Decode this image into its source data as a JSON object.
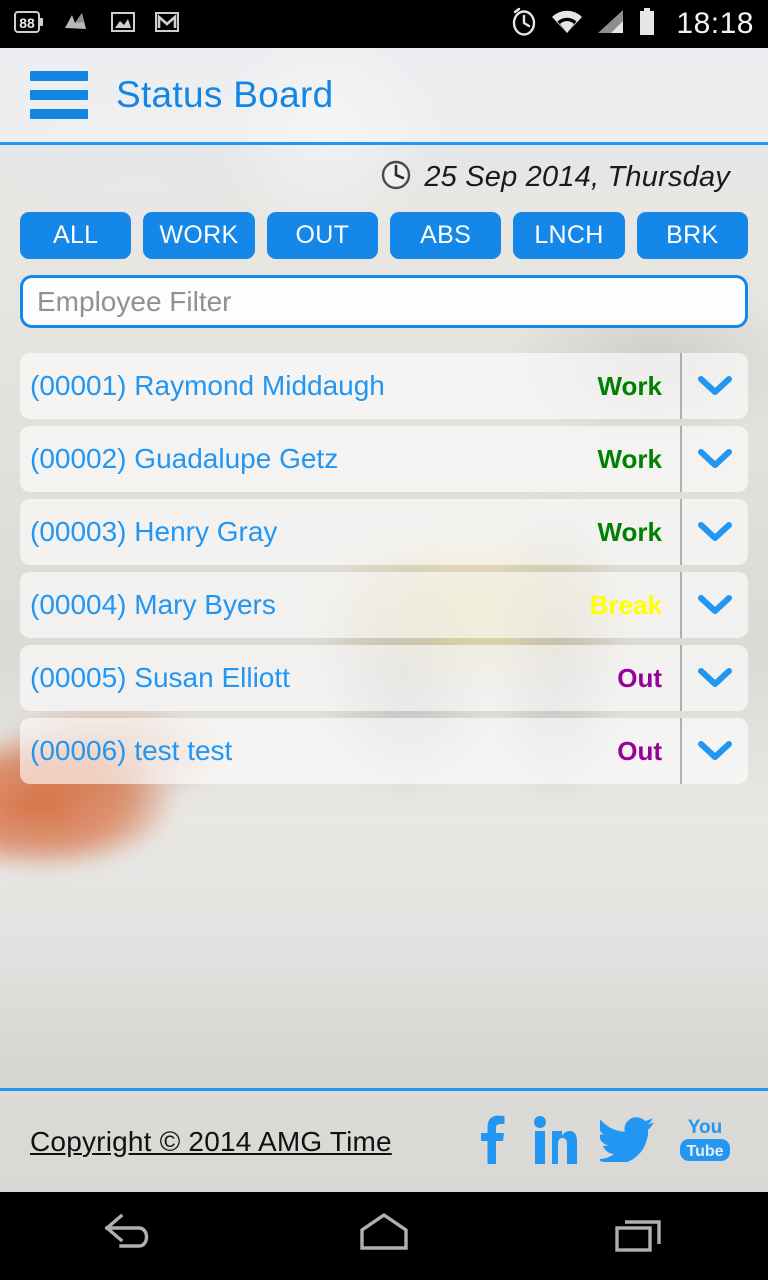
{
  "statusbar": {
    "icons": [
      {
        "name": "battery-88-badge-icon",
        "label": "88"
      },
      {
        "name": "sketch-app-icon",
        "label": ""
      },
      {
        "name": "gallery-image-icon",
        "label": ""
      },
      {
        "name": "gmail-icon",
        "label": ""
      }
    ],
    "right_icons": [
      {
        "name": "alarm-clock-icon"
      },
      {
        "name": "wifi-icon"
      },
      {
        "name": "cellular-signal-icon"
      },
      {
        "name": "battery-icon"
      }
    ],
    "time": "18:18"
  },
  "actionbar": {
    "menu_icon": "hamburger-menu-icon",
    "title": "Status Board"
  },
  "date_row": {
    "clock_icon": "clock-icon",
    "date": "25 Sep 2014, Thursday"
  },
  "filters": [
    {
      "id": "all",
      "label": "ALL"
    },
    {
      "id": "work",
      "label": "WORK"
    },
    {
      "id": "out",
      "label": "OUT"
    },
    {
      "id": "abs",
      "label": "ABS"
    },
    {
      "id": "lnch",
      "label": "LNCH"
    },
    {
      "id": "brk",
      "label": "BRK"
    }
  ],
  "search": {
    "placeholder": "Employee Filter",
    "value": ""
  },
  "status_colors": {
    "work": "#008000",
    "break": "#ffff00",
    "out": "#990099",
    "accent": "#1587e8",
    "name": "#2196f3"
  },
  "employees": [
    {
      "code": "(00001)",
      "name": "Raymond Middaugh",
      "display": "(00001) Raymond Middaugh",
      "status": "Work",
      "status_color": "#008000",
      "expand_icon": "chevron-down-icon"
    },
    {
      "code": "(00002)",
      "name": "Guadalupe Getz",
      "display": "(00002) Guadalupe Getz",
      "status": "Work",
      "status_color": "#008000",
      "expand_icon": "chevron-down-icon"
    },
    {
      "code": "(00003)",
      "name": "Henry Gray",
      "display": "(00003) Henry Gray",
      "status": "Work",
      "status_color": "#008000",
      "expand_icon": "chevron-down-icon"
    },
    {
      "code": "(00004)",
      "name": "Mary Byers",
      "display": "(00004) Mary Byers",
      "status": "Break",
      "status_color": "#ffff00",
      "expand_icon": "chevron-down-icon"
    },
    {
      "code": "(00005)",
      "name": "Susan Elliott",
      "display": "(00005) Susan Elliott",
      "status": "Out",
      "status_color": "#990099",
      "expand_icon": "chevron-down-icon"
    },
    {
      "code": "(00006)",
      "name": "test test",
      "display": "(00006) test test",
      "status": "Out",
      "status_color": "#990099",
      "expand_icon": "chevron-down-icon"
    }
  ],
  "footer": {
    "copyright": "Copyright © 2014 AMG Time",
    "social": [
      {
        "name": "facebook-icon",
        "label": "f"
      },
      {
        "name": "linkedin-icon",
        "label": "in"
      },
      {
        "name": "twitter-icon",
        "label": ""
      },
      {
        "name": "youtube-icon",
        "label": "You Tube"
      }
    ]
  },
  "navbar": [
    {
      "name": "nav-back-button"
    },
    {
      "name": "nav-home-button"
    },
    {
      "name": "nav-recents-button"
    }
  ]
}
